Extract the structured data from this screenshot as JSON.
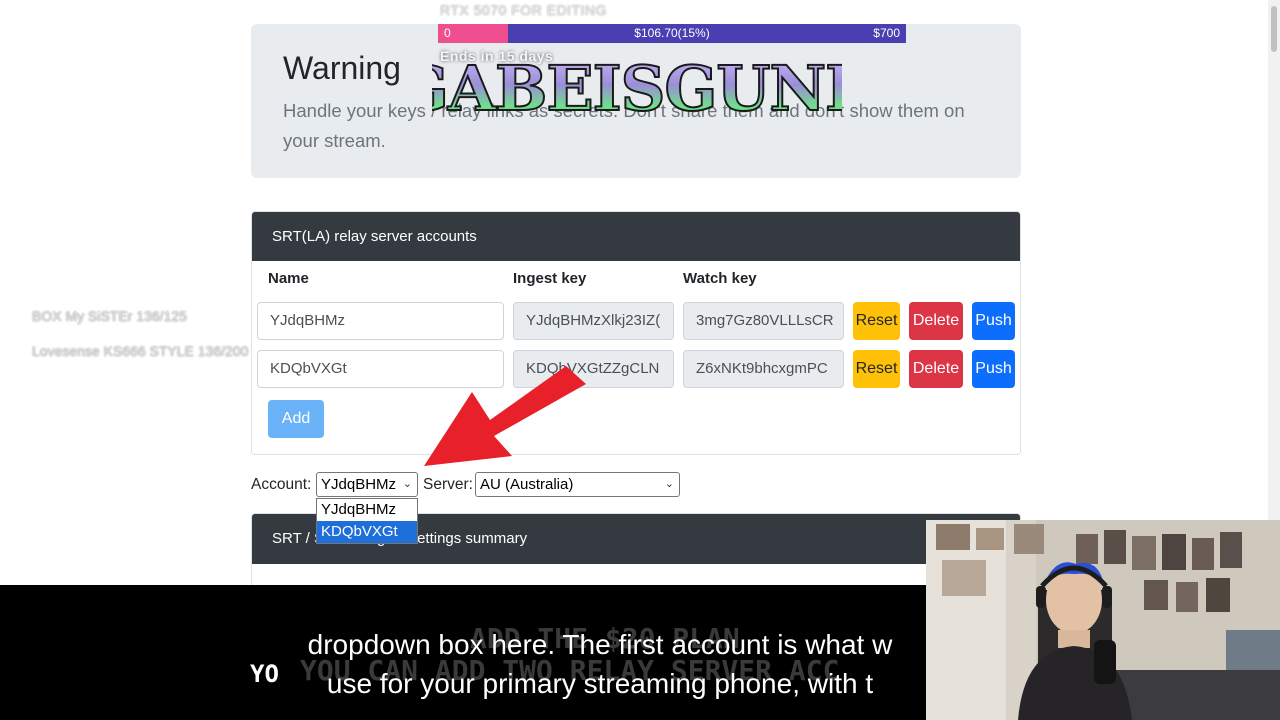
{
  "goal": {
    "title": "RTX 5070 FOR EDITING",
    "min": "0",
    "current": "$106.70(15%)",
    "max": "$700",
    "progress_fraction": 0.15,
    "ends": "Ends in 15 days"
  },
  "overlay_logo": "GABEISGUNK",
  "side_overlay": [
    "BOX My SiSTEr 136/125",
    "Lovesense KS666 STYLE 136/200"
  ],
  "warning": {
    "title": "Warning",
    "text": "Handle your keys / relay links as secrets. Don't share them and don't show them on your stream."
  },
  "accounts_card": {
    "header": "SRT(LA) relay server accounts",
    "columns": [
      "Name",
      "Ingest key",
      "Watch key"
    ],
    "rows": [
      {
        "name": "YJdqBHMz",
        "ingest": "YJdqBHMzXlkj23IZ(",
        "watch": "3mg7Gz80VLLLsCR"
      },
      {
        "name": "KDQbVXGt",
        "ingest": "KDQbVXGtZZgCLN",
        "watch": "Z6xNKt9bhcxgmPC"
      }
    ],
    "reset_label": "Reset",
    "delete_label": "Delete",
    "push_label": "Push",
    "add_label": "Add"
  },
  "selectors": {
    "account_label": "Account:",
    "account_value": "YJdqBHMz",
    "account_options": [
      "YJdqBHMz",
      "KDQbVXGt"
    ],
    "server_label": "Server:",
    "server_value": "AU (Australia)"
  },
  "summary_card": {
    "header": "SRT / SRTLA ingest settings summary"
  },
  "subtitles": {
    "line1": "dropdown box here. The first account is what w",
    "line2": "use for your primary streaming phone, with t",
    "ghost1": "ADD THE $20 PLAN",
    "ghost2": "YOU CAN ADD TWO RELAY SERVER ACC",
    "yo": "YO"
  },
  "colors": {
    "accent_pink": "#ef4f8f",
    "bar_purple": "#4a3fb0",
    "reset_yellow": "#ffc107",
    "delete_red": "#dc3545",
    "push_blue": "#0d6efd",
    "arrow_red": "#e8202a"
  }
}
